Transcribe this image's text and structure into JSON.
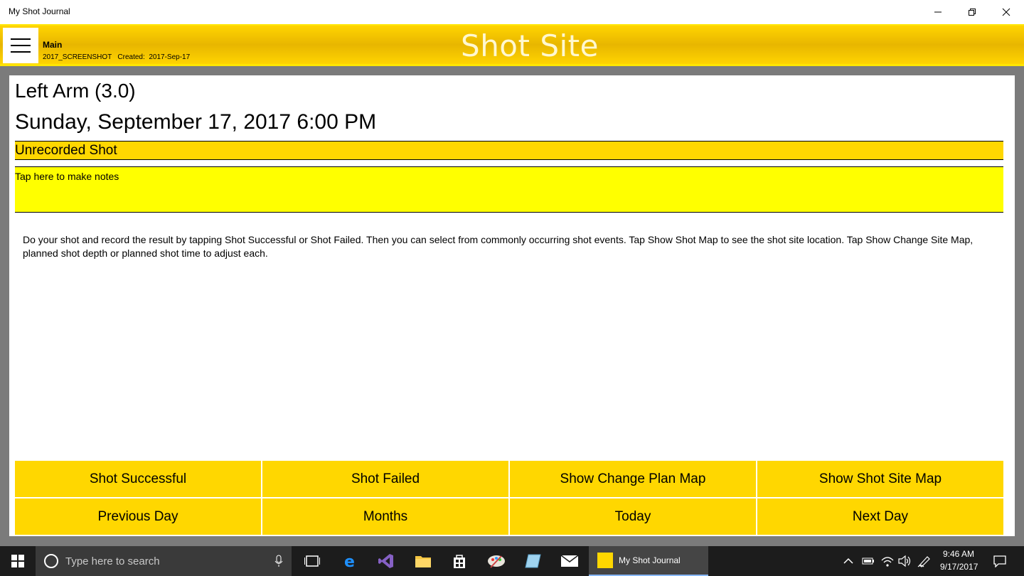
{
  "window": {
    "title": "My Shot Journal",
    "minimize_icon": "minimize-icon",
    "maximize_icon": "restore-icon",
    "close_icon": "close-icon"
  },
  "header": {
    "menu_icon": "hamburger-menu-icon",
    "section": "Main",
    "profile": "2017_SCREENSHOT",
    "created_label": "Created:",
    "created_date": "2017-Sep-17",
    "meta": "2017_SCREENSHOT   Created:  2017-Sep-17",
    "title": "Shot Site",
    "background_color": "#ffd400"
  },
  "shot": {
    "site": "Left Arm (3.0)",
    "date": "Sunday, September 17, 2017 6:00 PM",
    "status": "Unrecorded Shot",
    "notes_placeholder": "Tap here to make notes",
    "instructions": "Do your shot and record the result by tapping Shot Successful or Shot Failed.  Then you can select from commonly occurring shot events.  Tap Show Shot Map to see the shot site location.  Tap Show Change Site Map, planned shot depth or planned shot time to adjust each."
  },
  "buttons": {
    "shot_successful": "Shot Successful",
    "shot_failed": "Shot Failed",
    "show_change_plan_map": "Show Change Plan Map",
    "show_shot_site_map": "Show Shot Site Map",
    "previous_day": "Previous Day",
    "months": "Months",
    "today": "Today",
    "next_day": "Next Day",
    "color": "#ffd700"
  },
  "taskbar": {
    "search_placeholder": "Type here to search",
    "active_app": "My Shot Journal",
    "time": "9:46 AM",
    "date": "9/17/2017"
  }
}
